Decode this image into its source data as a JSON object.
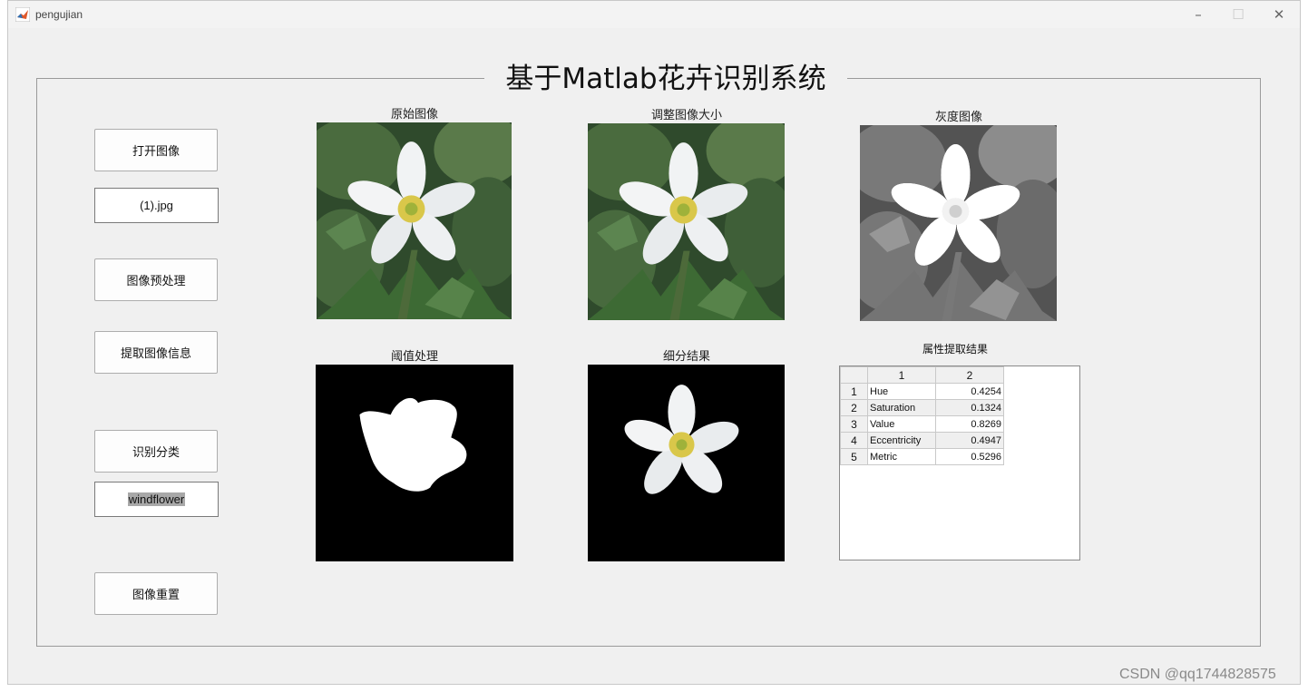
{
  "window": {
    "title": "pengujian"
  },
  "main_title": "基于Matlab花卉识别系统",
  "buttons": {
    "open_image": "打开图像",
    "preprocess": "图像预处理",
    "extract_info": "提取图像信息",
    "classify": "识别分类",
    "reset": "图像重置"
  },
  "fields": {
    "filename": "(1).jpg",
    "result": "windflower"
  },
  "captions": {
    "original": "原始图像",
    "resized": "调整图像大小",
    "gray": "灰度图像",
    "threshold": "阈值处理",
    "segmented": "细分结果",
    "table": "属性提取结果"
  },
  "table": {
    "columns": [
      "1",
      "2"
    ],
    "rows": [
      {
        "index": "1",
        "name": "Hue",
        "value": "0.4254"
      },
      {
        "index": "2",
        "name": "Saturation",
        "value": "0.1324"
      },
      {
        "index": "3",
        "name": "Value",
        "value": "0.8269"
      },
      {
        "index": "4",
        "name": "Eccentricity",
        "value": "0.4947"
      },
      {
        "index": "5",
        "name": "Metric",
        "value": "0.5296"
      }
    ]
  },
  "watermark": "CSDN @qq1744828575",
  "colors": {
    "window_bg": "#f0f0f0",
    "selection": "#a8a8a8"
  }
}
